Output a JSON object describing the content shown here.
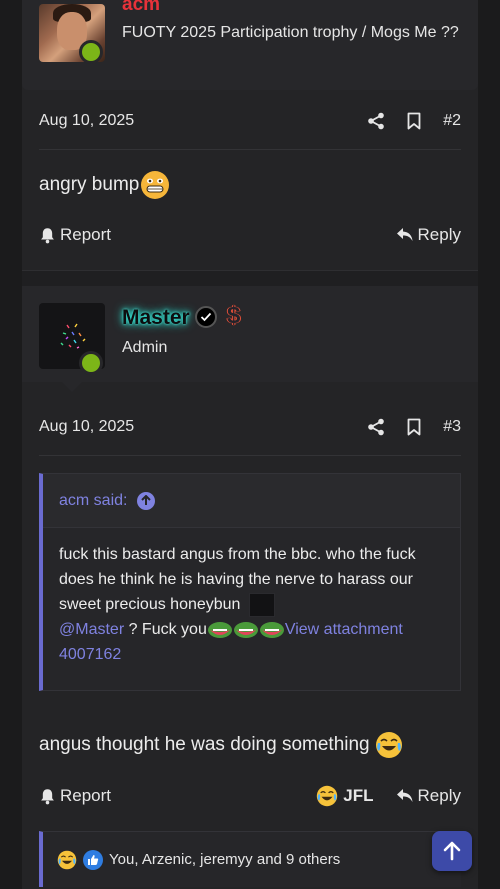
{
  "post2": {
    "username": "acm",
    "user_title": "FUOTY 2025 Participation trophy / Mogs Me ??",
    "date": "Aug 10, 2025",
    "post_number": "#2",
    "body": "angry bump",
    "report_label": "Report",
    "reply_label": "Reply"
  },
  "post3": {
    "username": "Master",
    "user_title": "Admin",
    "date": "Aug 10, 2025",
    "post_number": "#3",
    "quote": {
      "author_label": "acm said:",
      "text": "fuck this bastard angus from the bbc. who the fuck does he think he is having the nerve to harass our sweet precious honeybun",
      "mention": "@Master",
      "after_mention": " ? Fuck you",
      "attachment_link": "View attachment 4007162"
    },
    "body": "angus thought he was doing something",
    "report_label": "Report",
    "jfl_label": "JFL",
    "reply_label": "Reply",
    "reactions_text": "You, Arzenic, jeremyy and 9 others"
  },
  "colors": {
    "accent": "#7f82e0",
    "online": "#7cb518",
    "acm_name": "#e8323a",
    "master_glow": "#2de0d0"
  },
  "icons": [
    "share-icon",
    "bookmark-icon",
    "bell-icon",
    "reply-icon",
    "verified-icon",
    "dollar-icon",
    "arrow-up-icon",
    "cry-laugh-emoji",
    "grimace-emoji",
    "thumbs-up-icon"
  ]
}
